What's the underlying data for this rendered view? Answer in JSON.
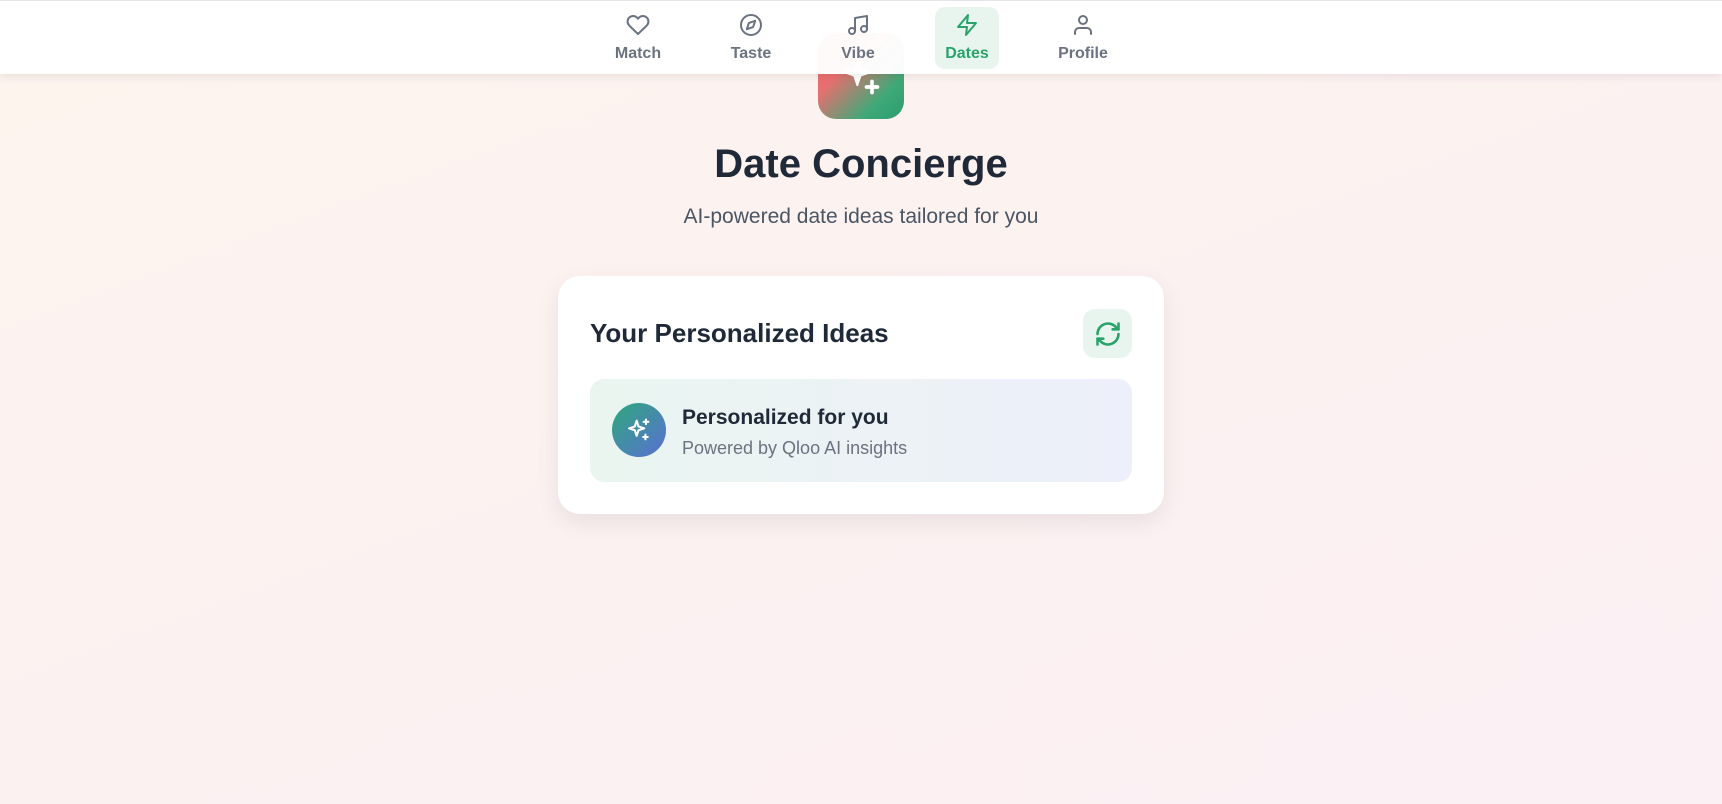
{
  "nav": {
    "items": [
      {
        "label": "Match",
        "icon": "heart-icon",
        "active": false
      },
      {
        "label": "Taste",
        "icon": "compass-icon",
        "active": false
      },
      {
        "label": "Vibe",
        "icon": "music-note-icon",
        "active": false
      },
      {
        "label": "Dates",
        "icon": "lightning-icon",
        "active": true
      },
      {
        "label": "Profile",
        "icon": "user-icon",
        "active": false
      }
    ]
  },
  "hero": {
    "logo_icon": "sparkles-icon",
    "title": "Date Concierge",
    "subtitle": "AI-powered date ideas tailored for you"
  },
  "card": {
    "title": "Your Personalized Ideas",
    "refresh_icon": "refresh-icon",
    "insight": {
      "icon": "sparkles-icon",
      "title": "Personalized for you",
      "subtitle": "Powered by Qloo AI insights"
    }
  },
  "colors": {
    "accent_green": "#2aa36b",
    "active_bg": "#e8f5ee",
    "text_dark": "#1f2937",
    "text_muted": "#6b7280",
    "logo_gradient_start": "#f26d6d",
    "logo_gradient_end": "#2a9d6f"
  }
}
